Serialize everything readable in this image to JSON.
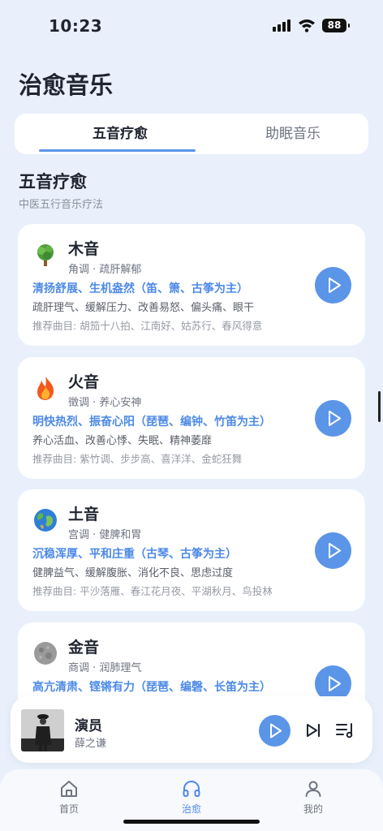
{
  "status_bar": {
    "time": "10:23",
    "battery": "88"
  },
  "page_title": "治愈音乐",
  "tabs": [
    {
      "label": "五音疗愈",
      "active": true
    },
    {
      "label": "助眠音乐",
      "active": false
    }
  ],
  "section": {
    "title": "五音疗愈",
    "subtitle": "中医五行音乐疗法"
  },
  "cards": [
    {
      "icon": "tree-icon",
      "name": "木音",
      "meta": "角调 · 疏肝解郁",
      "tagline": "清扬舒展、生机盎然（笛、箫、古筝为主）",
      "effects": "疏肝理气、缓解压力、改善易怒、偏头痛、眼干",
      "tracks_label": "推荐曲目:",
      "tracks": "胡笳十八拍、江南好、姑苏行、春风得意"
    },
    {
      "icon": "fire-icon",
      "name": "火音",
      "meta": "徵调 · 养心安神",
      "tagline": "明快热烈、振奋心阳（琵琶、编钟、竹笛为主）",
      "effects": "养心活血、改善心悸、失眠、精神萎靡",
      "tracks_label": "推荐曲目:",
      "tracks": "紫竹调、步步高、喜洋洋、金蛇狂舞"
    },
    {
      "icon": "earth-globe-icon",
      "name": "土音",
      "meta": "宫调 · 健脾和胃",
      "tagline": "沉稳浑厚、平和庄重（古琴、古筝为主）",
      "effects": "健脾益气、缓解腹胀、消化不良、思虑过度",
      "tracks_label": "推荐曲目:",
      "tracks": "平沙落雁、春江花月夜、平湖秋月、鸟投林"
    },
    {
      "icon": "moon-icon",
      "name": "金音",
      "meta": "商调 · 润肺理气",
      "tagline": "高亢清肃、铿锵有力（琵琶、编磬、长笛为主）",
      "effects": "",
      "tracks_label": "",
      "tracks": ""
    }
  ],
  "mini_player": {
    "title": "演员",
    "artist": "薛之谦"
  },
  "tabbar": [
    {
      "icon": "home-icon",
      "label": "首页",
      "active": false
    },
    {
      "icon": "headphones-icon",
      "label": "治愈",
      "active": true
    },
    {
      "icon": "person-icon",
      "label": "我的",
      "active": false
    }
  ],
  "colors": {
    "accent": "#5b95e8",
    "background": "#e9f0fb",
    "card": "#ffffff"
  }
}
